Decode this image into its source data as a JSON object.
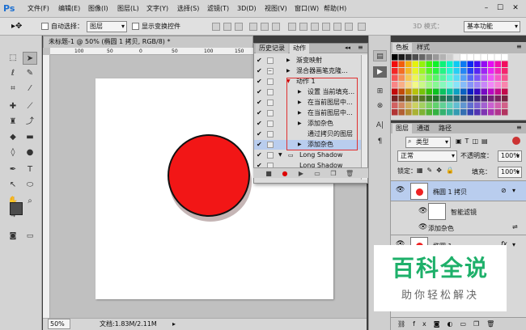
{
  "app": {
    "logo": "Ps"
  },
  "menu": [
    "文件(F)",
    "编辑(E)",
    "图像(I)",
    "图层(L)",
    "文字(Y)",
    "选择(S)",
    "滤镜(T)",
    "3D(D)",
    "视图(V)",
    "窗口(W)",
    "帮助(H)"
  ],
  "window_controls": [
    "–",
    "☐",
    "✕"
  ],
  "options_bar": {
    "auto_select_label": "自动选择：",
    "auto_select_value": "图层",
    "show_transform_label": "显示变换控件",
    "mode_3d_label": "3D 模式：",
    "workspace_value": "基本功能"
  },
  "document": {
    "tab_title": "未标题-1 @ 50% (椭圆 1 拷贝, RGB/8) *",
    "ruler_marks": [
      "100",
      "50",
      "0",
      "50",
      "100",
      "150",
      "200",
      "250"
    ],
    "circle_color": "#f21616"
  },
  "status": {
    "zoom": "50%",
    "doc_info": "文档:1.83M/2.11M"
  },
  "actions_panel": {
    "tabs": [
      "历史记录",
      "动作"
    ],
    "rows": [
      {
        "label": "渐变映射",
        "indent": 0
      },
      {
        "label": "混合器画笔克隆...",
        "indent": 0
      },
      {
        "label": "动作 1",
        "indent": 0
      },
      {
        "label": "设置 当前填充...",
        "indent": 1
      },
      {
        "label": "在当前图层中...",
        "indent": 1
      },
      {
        "label": "在当前图层中...",
        "indent": 1
      },
      {
        "label": "添加杂色",
        "indent": 1
      },
      {
        "label": "通过拷贝的图层",
        "indent": 1
      },
      {
        "label": "添加杂色",
        "indent": 1
      },
      {
        "label": "Long Shadow",
        "indent": 0
      },
      {
        "label": "Long Shadow",
        "indent": 0
      }
    ]
  },
  "swatches_panel": {
    "tabs": [
      "色板",
      "样式"
    ]
  },
  "layers_panel": {
    "tabs": [
      "图层",
      "通道",
      "路径"
    ],
    "kind_label": "类型",
    "blend_mode": "正常",
    "opacity_label": "不透明度：",
    "opacity_value": "100%",
    "lock_label": "锁定：",
    "fill_label": "填充：",
    "fill_value": "100%",
    "layers": [
      {
        "name": "椭圆 1 拷贝",
        "selected": true
      },
      {
        "name": "智能滤镜",
        "selected": false
      },
      {
        "name": "添加杂色",
        "selected": false
      },
      {
        "name": "椭圆 1",
        "selected": false
      }
    ]
  },
  "watermark": {
    "title": "百科全说",
    "subtitle": "助你轻松解决"
  }
}
